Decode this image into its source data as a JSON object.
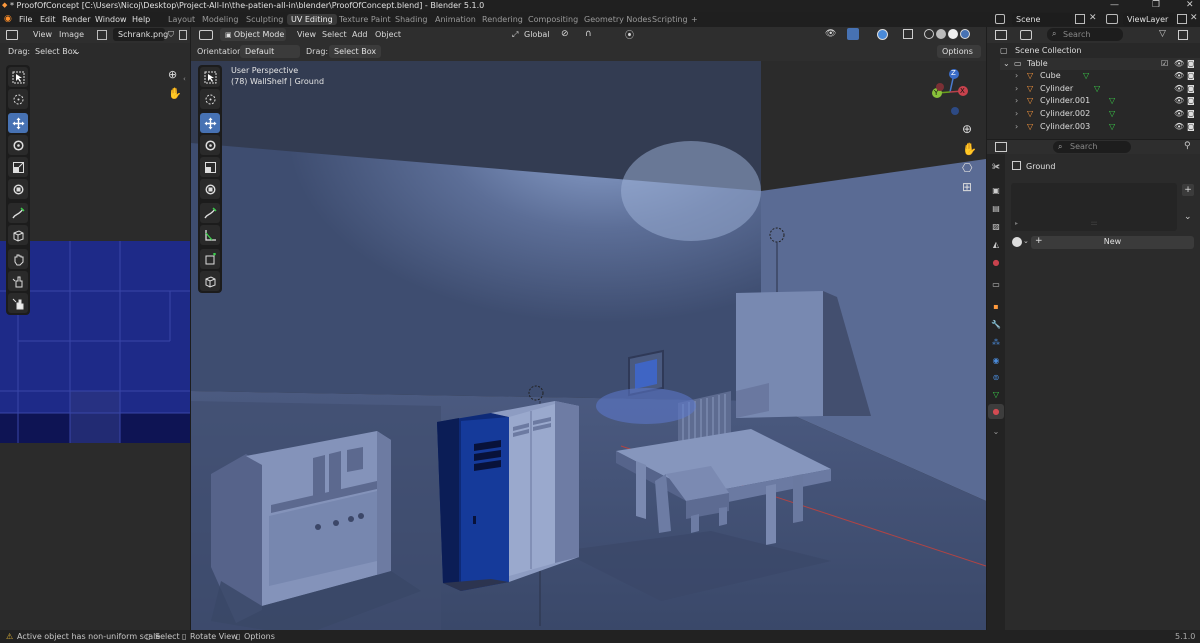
{
  "window": {
    "title": "* ProofOfConcept [C:\\Users\\Nicoj\\Desktop\\Project-All-In\\the-patien-all-in\\blender\\ProofOfConcept.blend] - Blender 5.1.0",
    "controls": [
      "—",
      "❐",
      "✕"
    ]
  },
  "menu": [
    "File",
    "Edit",
    "Render",
    "Window",
    "Help"
  ],
  "workspaces": {
    "tabs": [
      "Layout",
      "Modeling",
      "Sculpting",
      "UV Editing",
      "Texture Paint",
      "Shading",
      "Animation",
      "Rendering",
      "Compositing",
      "Geometry Nodes",
      "Scripting"
    ],
    "active": "UV Editing",
    "add": "+"
  },
  "scene": {
    "name": "Scene",
    "view_layer": "ViewLayer"
  },
  "image_editor": {
    "menus": [
      "View",
      "Image"
    ],
    "image_name": "Schrank.png",
    "drag_label": "Drag:",
    "drag_value": "Select Box"
  },
  "viewport": {
    "mode": "Object Mode",
    "menus": [
      "View",
      "Select",
      "Add",
      "Object"
    ],
    "orientation_label": "Orientation:",
    "orientation_value": "Default",
    "drag_label": "Drag:",
    "drag_value": "Select Box",
    "transform_space": "Global",
    "options": "Options",
    "overlay_title": "User Perspective",
    "overlay_sub": "(78) WallShelf | Ground",
    "gizmo": {
      "x": "X",
      "y": "Y",
      "z": "Z"
    }
  },
  "outliner": {
    "search_placeholder": "Search",
    "root": "Scene Collection",
    "collection": "Table",
    "items": [
      "Cube",
      "Cylinder",
      "Cylinder.001",
      "Cylinder.002",
      "Cylinder.003"
    ]
  },
  "properties": {
    "search_placeholder": "Search",
    "material_slot": "Ground",
    "new_button": "New",
    "dots": ":::"
  },
  "status": {
    "warning": "Active object has non-uniform scale",
    "select": "Select",
    "rotate": "Rotate View",
    "options": "Options",
    "version": "5.1.0"
  },
  "colors": {
    "accent": "#4772b3",
    "uv_background": "#1c2a7a",
    "viewport_wall": "#5d6e95"
  }
}
